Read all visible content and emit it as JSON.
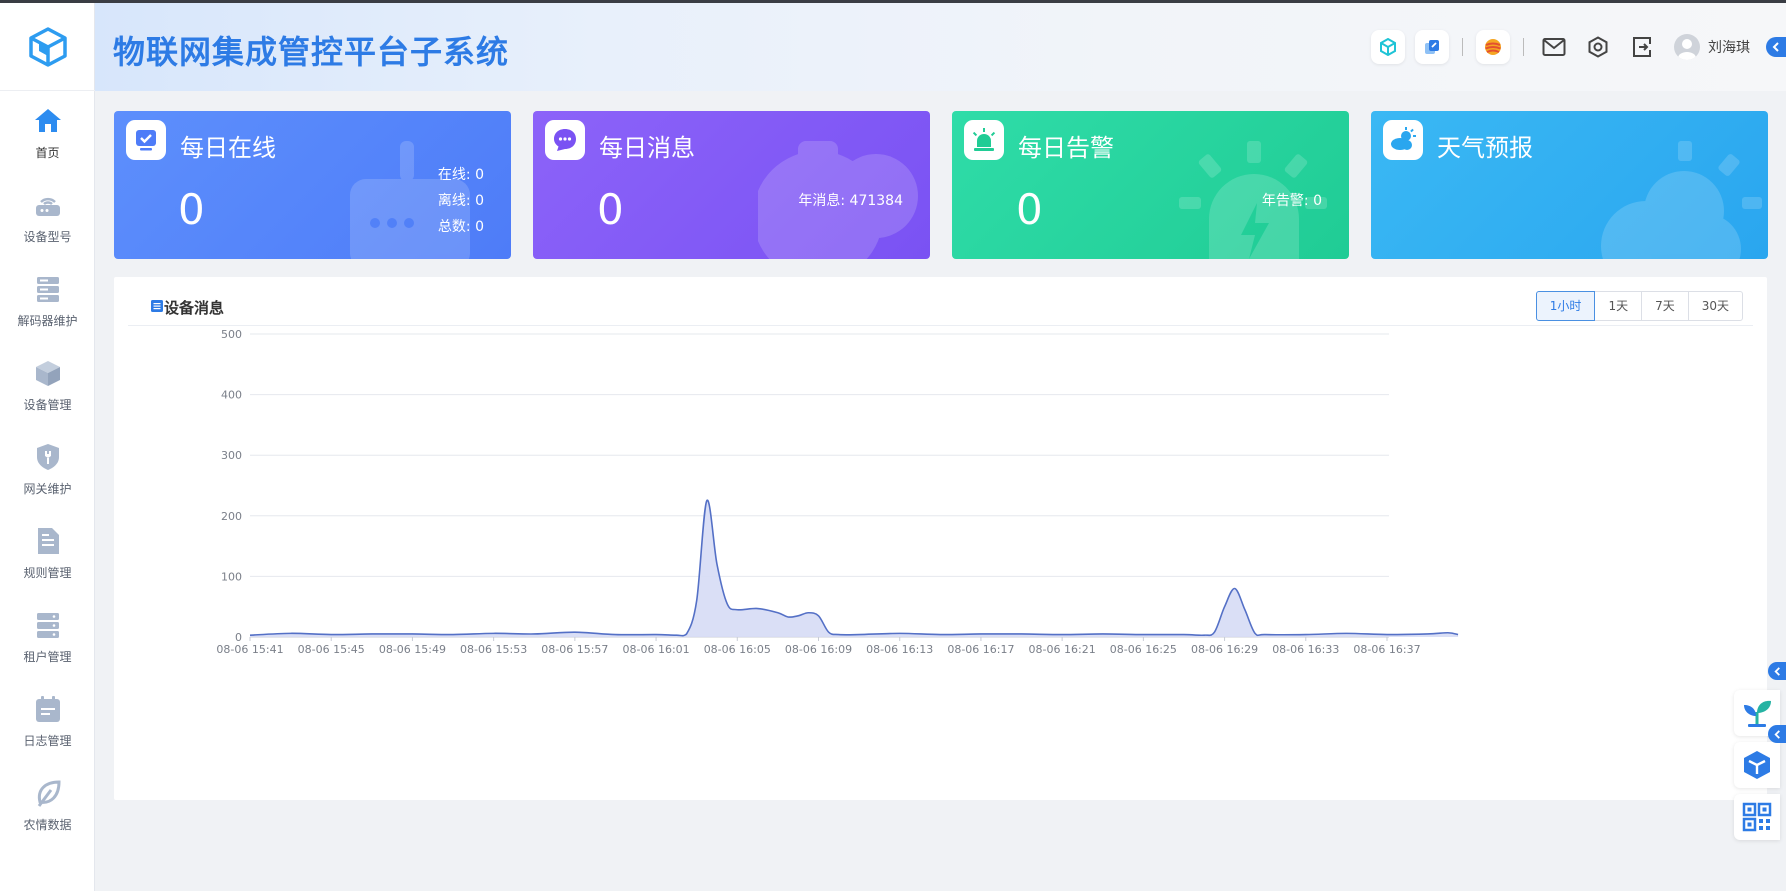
{
  "app": {
    "title": "物联网集成管控平台子系统"
  },
  "header": {
    "username": "刘海琪"
  },
  "sidebar": {
    "items": [
      {
        "label": "首页",
        "icon": "home-icon"
      },
      {
        "label": "设备型号",
        "icon": "router-icon"
      },
      {
        "label": "解码器维护",
        "icon": "server-icon"
      },
      {
        "label": "设备管理",
        "icon": "cube-icon"
      },
      {
        "label": "网关维护",
        "icon": "shield-wrench-icon"
      },
      {
        "label": "规则管理",
        "icon": "document-icon"
      },
      {
        "label": "租户管理",
        "icon": "database-icon"
      },
      {
        "label": "日志管理",
        "icon": "calendar-icon"
      },
      {
        "label": "农情数据",
        "icon": "leaf-icon"
      }
    ]
  },
  "cards": {
    "online": {
      "title": "每日在线",
      "value": "0",
      "online_label": "在线: 0",
      "offline_label": "离线: 0",
      "total_label": "总数: 0"
    },
    "messages": {
      "title": "每日消息",
      "value": "0",
      "year_label": "年消息: 471384"
    },
    "alarms": {
      "title": "每日告警",
      "value": "0",
      "year_label": "年告警: 0"
    },
    "weather": {
      "title": "天气预报"
    }
  },
  "panel": {
    "title": "设备消息",
    "ranges": [
      "1小时",
      "1天",
      "7天",
      "30天"
    ],
    "active_range": "1小时"
  },
  "colors": {
    "primary": "#2d7be5",
    "line": "#5470c6",
    "area": "#d6dcf5"
  },
  "chart_data": {
    "type": "area",
    "x_ticks": [
      "08-06 15:41",
      "08-06 15:45",
      "08-06 15:49",
      "08-06 15:53",
      "08-06 15:57",
      "08-06 16:01",
      "08-06 16:05",
      "08-06 16:09",
      "08-06 16:13",
      "08-06 16:17",
      "08-06 16:21",
      "08-06 16:25",
      "08-06 16:29",
      "08-06 16:33",
      "08-06 16:37"
    ],
    "x_minutes": [
      0,
      2,
      4,
      6,
      8,
      10,
      12,
      14,
      16,
      18,
      20,
      21,
      21.5,
      22,
      22.5,
      23,
      23.5,
      24,
      25,
      26,
      26.5,
      27,
      27.5,
      28,
      28.5,
      29,
      30,
      32,
      34,
      36,
      38,
      40,
      42,
      44,
      46,
      47,
      47.5,
      48,
      48.5,
      49,
      49.5,
      50,
      52,
      54,
      56,
      58,
      59,
      59.5
    ],
    "y_values": [
      3,
      6,
      4,
      5,
      5,
      4,
      6,
      5,
      8,
      4,
      4,
      3,
      5,
      60,
      225,
      120,
      55,
      45,
      47,
      40,
      33,
      35,
      40,
      35,
      8,
      4,
      4,
      6,
      4,
      5,
      5,
      4,
      5,
      4,
      4,
      3,
      8,
      50,
      80,
      45,
      6,
      4,
      4,
      6,
      4,
      5,
      7,
      4
    ],
    "yticks": [
      0,
      100,
      200,
      300,
      400,
      500
    ],
    "ylim": [
      0,
      500
    ],
    "grid": true
  }
}
